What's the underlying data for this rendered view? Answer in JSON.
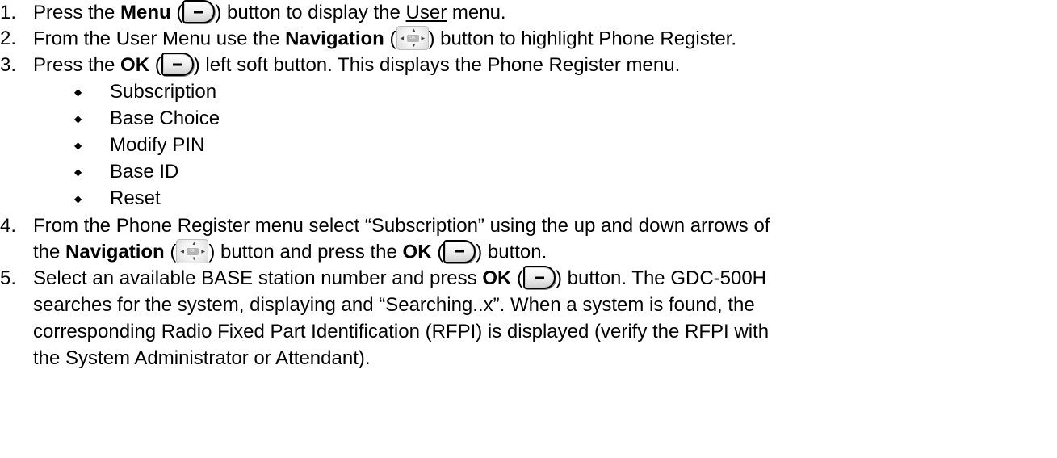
{
  "steps": {
    "s1": {
      "num": "1.",
      "pre": "Press the ",
      "bold": "Menu",
      "open": " (",
      "mid": ") button to display the ",
      "u": "User",
      "post": " menu."
    },
    "s2": {
      "num": "2.",
      "pre": "From the User Menu use the ",
      "bold": "Navigation",
      "open": " (",
      "post": ") button to highlight Phone Register."
    },
    "s3": {
      "num": "3.",
      "pre": "Press the ",
      "bold": "OK",
      "open": " (",
      "post": ") left soft button.  This displays the Phone Register menu."
    },
    "submenu": [
      "Subscription",
      "Base Choice",
      "Modify PIN",
      "Base ID",
      "Reset"
    ],
    "s4": {
      "num": "4.",
      "line1": "From the Phone Register menu select “Subscription” using the up and down arrows of",
      "pre2": "the ",
      "bold1": "Navigation",
      "open1": " (",
      "mid2": ") button and press the ",
      "bold2": "OK",
      "open2": " (",
      "post2": ") button."
    },
    "s5": {
      "num": "5.",
      "pre": "Select an available BASE station number and press ",
      "bold": "OK",
      "open": " (",
      "post": ") button.  The GDC-500H",
      "line2": "searches for the system, displaying and “Searching..x”.  When a system is found, the",
      "line3": "corresponding Radio Fixed Part Identification (RFPI) is displayed (verify the RFPI with",
      "line4": "the System Administrator or Attendant)."
    }
  },
  "icons": {
    "soft_key": "soft-key-minus-icon",
    "nav_key": "navigation-ok-icon"
  },
  "colors": {
    "text": "#000000",
    "background": "#ffffff"
  }
}
